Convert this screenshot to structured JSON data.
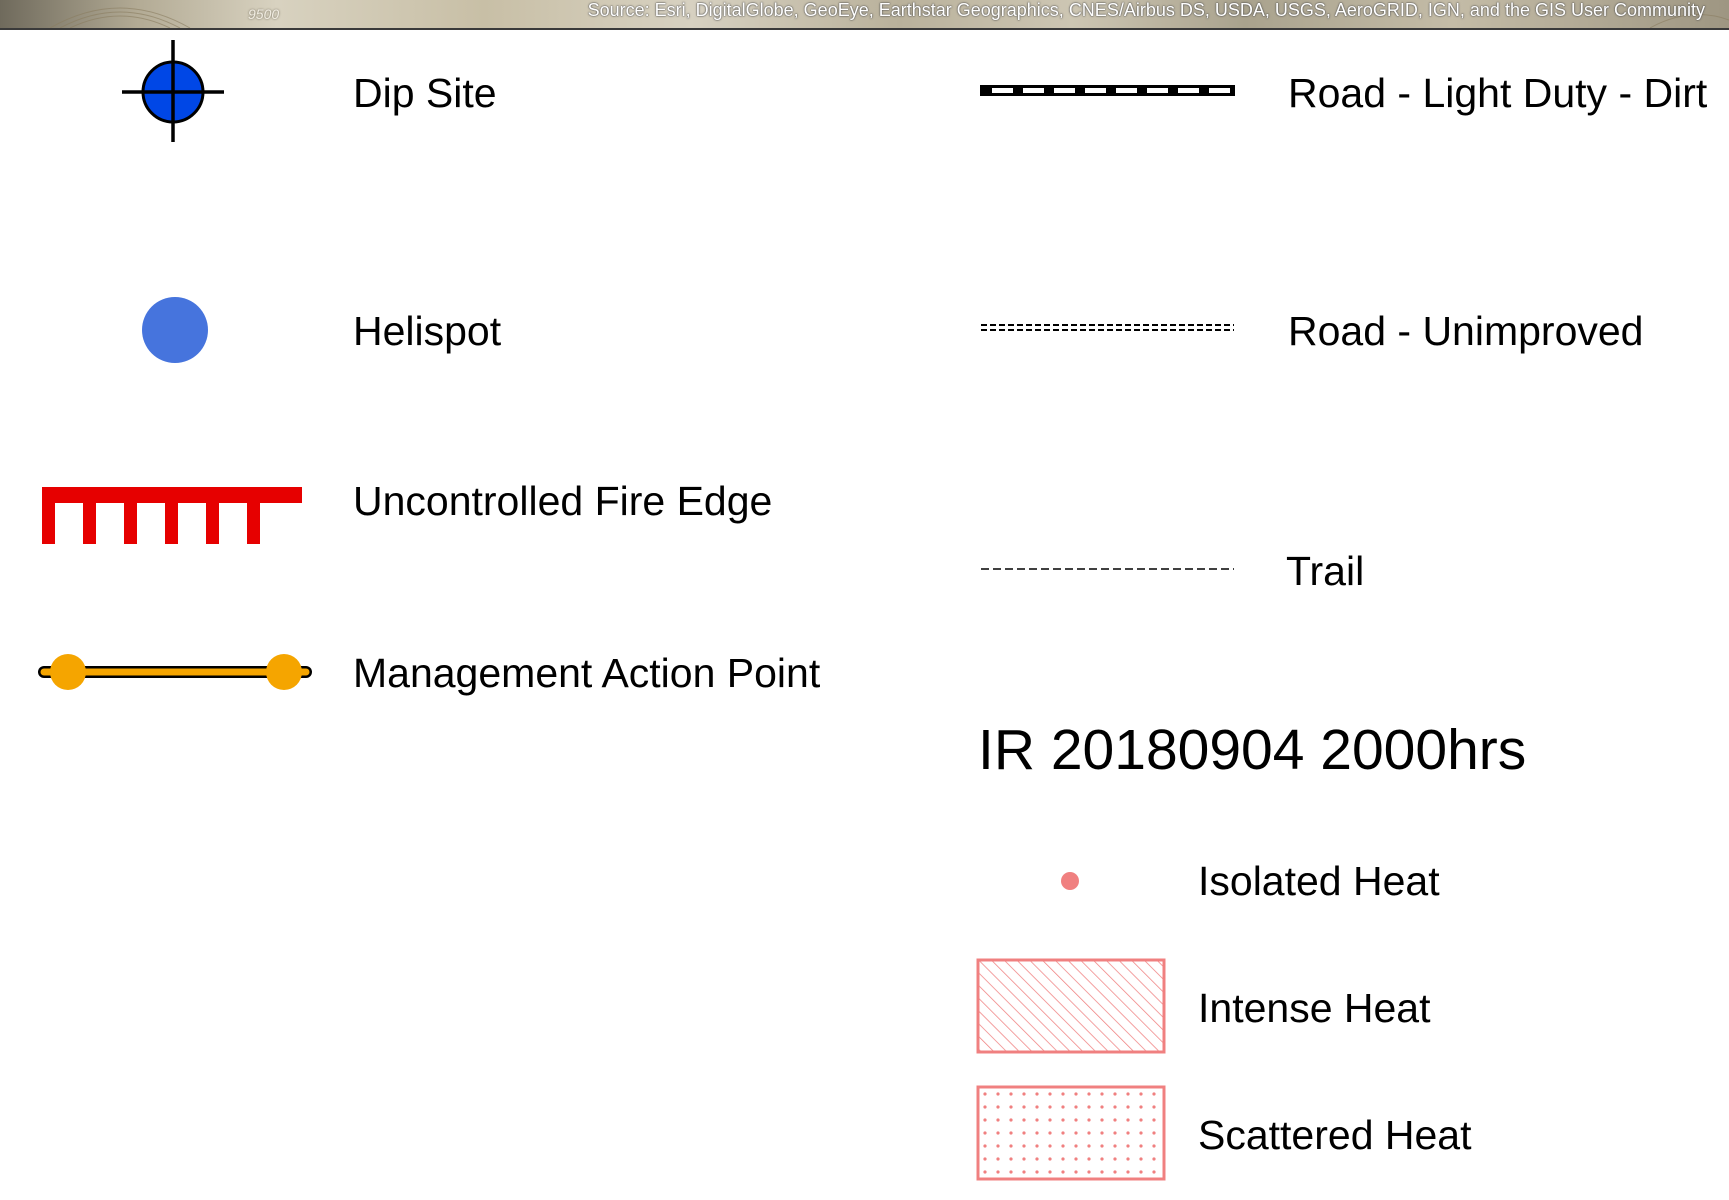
{
  "map_strip": {
    "credit": "Source: Esri, DigitalGlobe, GeoEye, Earthstar Geographics, CNES/Airbus DS, USDA, USGS, AeroGRID, IGN, and the GIS User Community",
    "contour_label": "9500"
  },
  "legend": {
    "left_column": [
      {
        "label": "Dip Site",
        "icon": "dip-site-icon",
        "color": "#0047e6"
      },
      {
        "label": "Helispot",
        "icon": "helispot-icon",
        "color": "#4674dd"
      },
      {
        "label": "Uncontrolled Fire Edge",
        "icon": "fire-edge-icon",
        "color": "#e60000"
      },
      {
        "label": "Management Action Point",
        "icon": "map-line-icon",
        "color": "#f5a500"
      }
    ],
    "right_column": [
      {
        "label": "Road - Light Duty - Dirt",
        "icon": "road-light-duty-icon"
      },
      {
        "label": "Road - Unimproved",
        "icon": "road-unimproved-icon"
      },
      {
        "label": "Trail",
        "icon": "trail-icon"
      }
    ],
    "ir_section": {
      "title": "IR 20180904 2000hrs",
      "items": [
        {
          "label": "Isolated Heat",
          "icon": "isolated-heat-icon",
          "color": "#f08080"
        },
        {
          "label": "Intense Heat",
          "icon": "intense-heat-icon",
          "color": "#f08080"
        },
        {
          "label": "Scattered Heat",
          "icon": "scattered-heat-icon",
          "color": "#f08080"
        }
      ]
    }
  }
}
